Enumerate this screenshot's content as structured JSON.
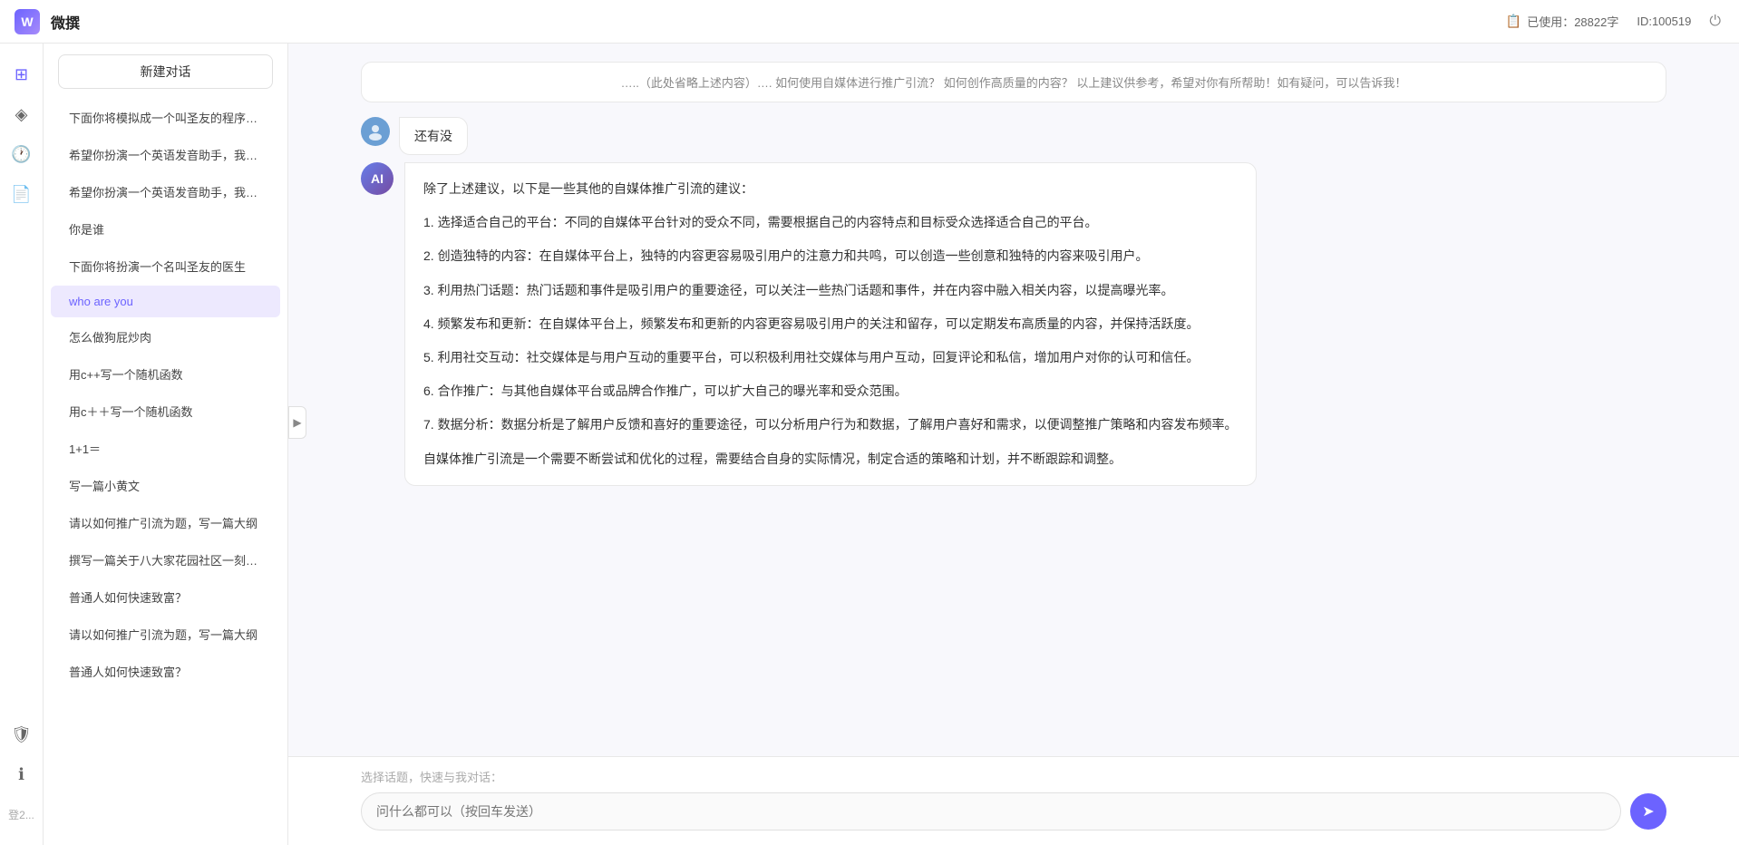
{
  "topbar": {
    "title": "微撰",
    "usage_label": "已使用：28822字",
    "id_label": "ID:100519",
    "usage_icon": "📋"
  },
  "sidebar": {
    "new_chat": "新建对话",
    "items": [
      {
        "label": "下面你将模拟成一个叫圣友的程序员，我说...",
        "active": false
      },
      {
        "label": "希望你扮演一个英语发音助手，我提供给你...",
        "active": false
      },
      {
        "label": "希望你扮演一个英语发音助手，我提供给你...",
        "active": false
      },
      {
        "label": "你是谁",
        "active": false
      },
      {
        "label": "下面你将扮演一个名叫圣友的医生",
        "active": false
      },
      {
        "label": "who are you",
        "active": true
      },
      {
        "label": "怎么做狗屁炒肉",
        "active": false
      },
      {
        "label": "用c++写一个随机函数",
        "active": false
      },
      {
        "label": "用c＋＋写一个随机函数",
        "active": false
      },
      {
        "label": "1+1＝",
        "active": false
      },
      {
        "label": "写一篇小黄文",
        "active": false
      },
      {
        "label": "请以如何推广引流为题，写一篇大纲",
        "active": false
      },
      {
        "label": "撰写一篇关于八大家花园社区一刻钟便民生...",
        "active": false
      },
      {
        "label": "普通人如何快速致富？",
        "active": false
      },
      {
        "label": "请以如何推广引流为题，写一篇大纲",
        "active": false
      },
      {
        "label": "普通人如何快速致富？",
        "active": false
      }
    ]
  },
  "chat": {
    "truncated_text": "…..（此处省略上述内容）…. 如何使用自媒体进行推广引流？ 如何创作高质量的内容？ 以上建议供参考，希望对你有所帮助！如有疑问，可以告诉我！",
    "user_message": "还有没",
    "ai_response": {
      "paragraphs": [
        "除了上述建议，以下是一些其他的自媒体推广引流的建议：",
        "1. 选择适合自己的平台：不同的自媒体平台针对的受众不同，需要根据自己的内容特点和目标受众选择适合自己的平台。",
        "2. 创造独特的内容：在自媒体平台上，独特的内容更容易吸引用户的注意力和共鸣，可以创造一些创意和独特的内容来吸引用户。",
        "3. 利用热门话题：热门话题和事件是吸引用户的重要途径，可以关注一些热门话题和事件，并在内容中融入相关内容，以提高曝光率。",
        "4. 频繁发布和更新：在自媒体平台上，频繁发布和更新的内容更容易吸引用户的关注和留存，可以定期发布高质量的内容，并保持活跃度。",
        "5. 利用社交互动：社交媒体是与用户互动的重要平台，可以积极利用社交媒体与用户互动，回复评论和私信，增加用户对你的认可和信任。",
        "6. 合作推广：与其他自媒体平台或品牌合作推广，可以扩大自己的曝光率和受众范围。",
        "7. 数据分析：数据分析是了解用户反馈和喜好的重要途径，可以分析用户行为和数据，了解用户喜好和需求，以便调整推广策略和内容发布频率。",
        "自媒体推广引流是一个需要不断尝试和优化的过程，需要结合自身的实际情况，制定合适的策略和计划，并不断跟踪和调整。"
      ]
    }
  },
  "input": {
    "quick_label": "选择话题，快速与我对话：",
    "placeholder": "问什么都可以（按回车发送）",
    "send_icon": "➤"
  },
  "icons": {
    "logo": "W",
    "ai_avatar": "AI",
    "toggle": "▶"
  }
}
